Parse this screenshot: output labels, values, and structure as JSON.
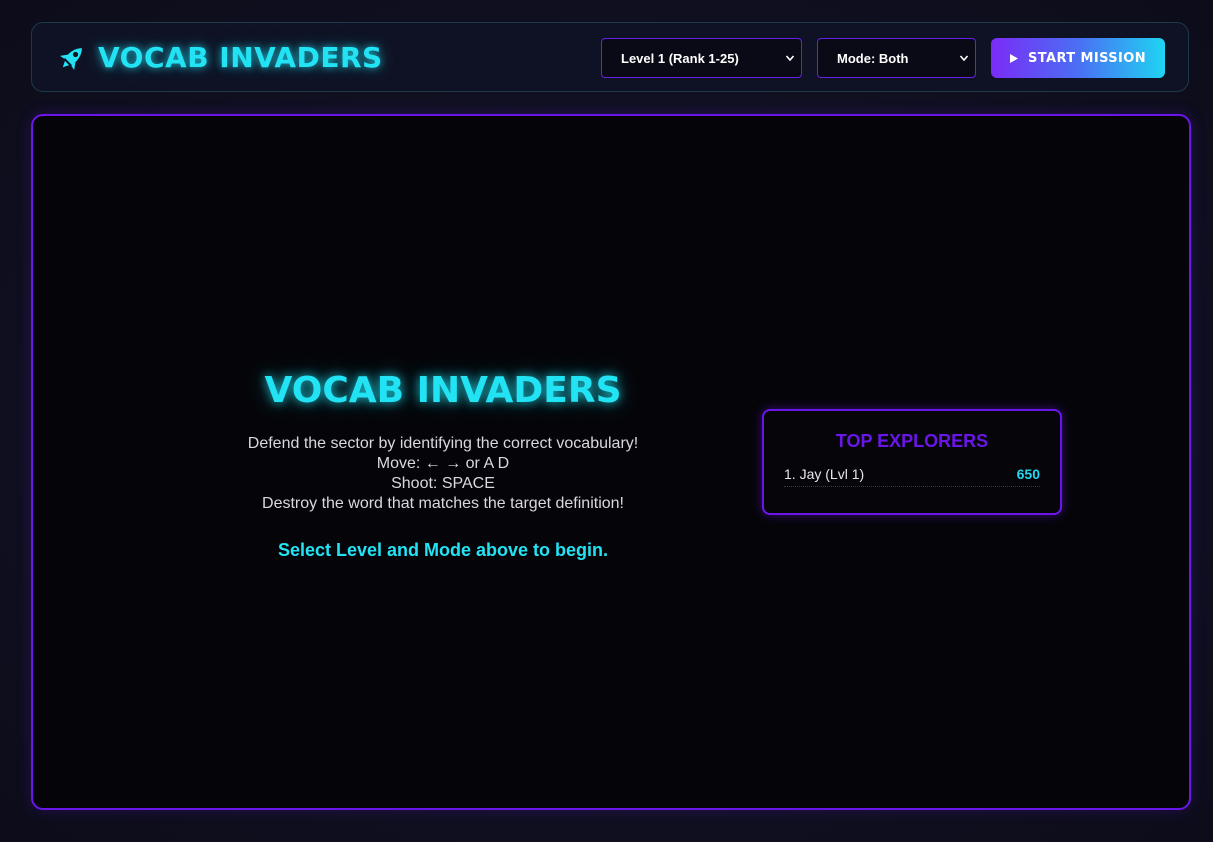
{
  "header": {
    "title": "VOCAB INVADERS",
    "level_select": "Level 1 (Rank 1-25)",
    "mode_select": "Mode: Both",
    "start_label": "START MISSION"
  },
  "intro": {
    "title": "VOCAB INVADERS",
    "lines": [
      "Defend the sector by identifying the correct vocabulary!",
      "Move: ← → or A D",
      "Shoot: SPACE",
      "Destroy the word that matches the target definition!"
    ],
    "cta": "Select Level and Mode above to begin."
  },
  "leaderboard": {
    "title": "TOP EXPLORERS",
    "entries": [
      {
        "name": "1. Jay (Lvl 1)",
        "score": "650"
      }
    ]
  },
  "colors": {
    "accent_cyan": "#22e3f4",
    "accent_purple": "#6a16e8",
    "background": "#050509"
  },
  "icons": {
    "brand": "rocket-icon",
    "start": "play-icon",
    "select": "chevron-down-icon"
  }
}
